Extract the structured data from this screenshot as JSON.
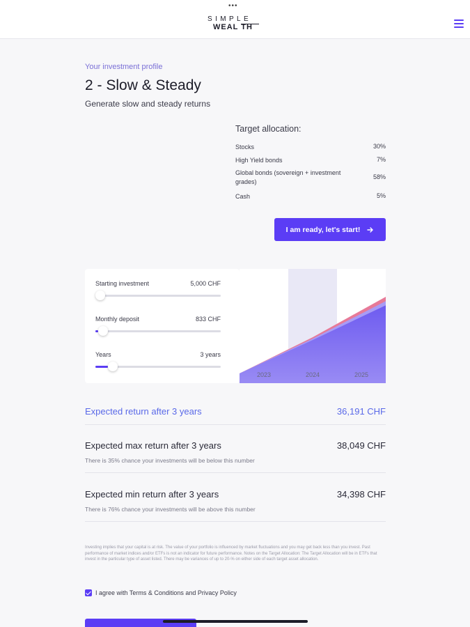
{
  "header": {
    "logo_line1": "SIMPLE",
    "logo_line2": "WEAL  TH",
    "menu_icon": "hamburger-menu-icon"
  },
  "profile": {
    "label": "Your investment profile",
    "title": "2 -  Slow & Steady",
    "subtitle": "Generate slow and steady returns"
  },
  "allocation": {
    "title": "Target allocation:",
    "items": [
      {
        "name": "Stocks",
        "pct": "30%"
      },
      {
        "name": "High Yield bonds",
        "pct": "7%"
      },
      {
        "name": "Global bonds (sovereign + investment grades)",
        "pct": "58%"
      },
      {
        "name": "Cash",
        "pct": "5%"
      }
    ]
  },
  "cta": {
    "label": "I am ready, let's start!",
    "icon": "arrow-right-icon"
  },
  "simulator": {
    "starting": {
      "label": "Starting investment",
      "value": "5,000 CHF",
      "level": 0
    },
    "monthly": {
      "label": "Monthly deposit",
      "value": "833 CHF",
      "level": 0.02
    },
    "years": {
      "label": "Years",
      "value": "3 years",
      "level": 0.1
    }
  },
  "chart_data": {
    "type": "area",
    "categories": [
      "2023",
      "2024",
      "2025"
    ],
    "highlight_category": "2024",
    "series": [
      {
        "values": [
          5000,
          20600,
          38049
        ]
      },
      {
        "values": [
          5000,
          20000,
          36191
        ]
      },
      {
        "values": [
          5000,
          19400,
          34398
        ]
      }
    ],
    "colors": {
      "max": "#e77a98",
      "expected": "#a89cf5",
      "min": "#6b58f0",
      "highlight_band": "#e9e8f6"
    }
  },
  "results": {
    "expected": {
      "title": "Expected return after 3 years",
      "value": "36,191 CHF"
    },
    "max": {
      "title": "Expected max return after 3 years",
      "value": "38,049 CHF",
      "note": "There is 35% chance your investments will be below this number"
    },
    "min": {
      "title": "Expected min return after 3 years",
      "value": "34,398 CHF",
      "note": "There is 76% chance your investments will be above this number"
    }
  },
  "disclaimer": "Investing implies that your capital is at risk. The value of your portfolio is influenced by market fluctuations and you may get back less than you invest. Past performance of market indices and/or ETFs is not an indicator for future performance. Notes on the Target Allocation: The Target Allocation will be in ETFs that invest in the particular type of asset listed. There may be variances of up to 20-% on either side of each target asset allocation.",
  "terms": {
    "label": "I agree with Terms & Conditions and Privacy Policy",
    "checked": true
  },
  "colors": {
    "accent": "#5b3df5",
    "highlight_text": "#5a69e8"
  }
}
